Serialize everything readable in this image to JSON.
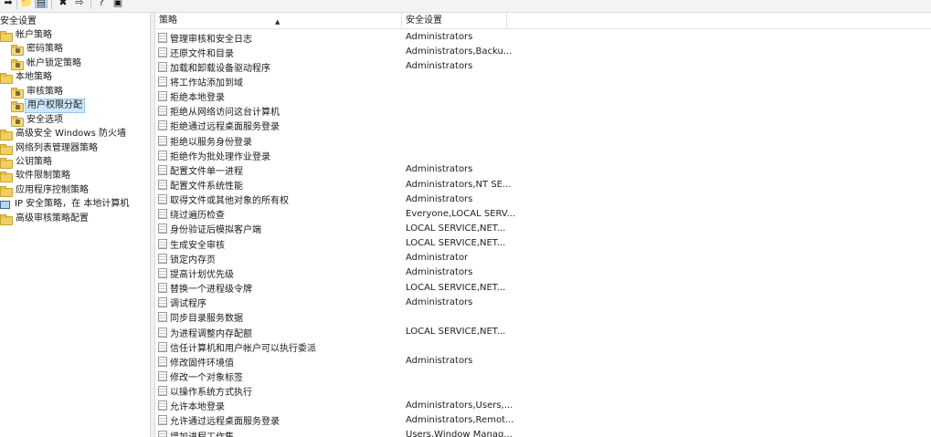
{
  "tree": {
    "items": [
      {
        "label": "安全设置",
        "kind": "root"
      },
      {
        "label": "帐户策略",
        "kind": "folder"
      },
      {
        "label": "密码策略",
        "kind": "locked"
      },
      {
        "label": "帐户锁定策略",
        "kind": "locked"
      },
      {
        "label": "本地策略",
        "kind": "folder"
      },
      {
        "label": "审核策略",
        "kind": "locked"
      },
      {
        "label": "用户权限分配",
        "kind": "locked",
        "selected": true
      },
      {
        "label": "安全选项",
        "kind": "locked"
      },
      {
        "label": "高级安全 Windows 防火墙",
        "kind": "folder"
      },
      {
        "label": "网络列表管理器策略",
        "kind": "folder"
      },
      {
        "label": "公钥策略",
        "kind": "folder"
      },
      {
        "label": "软件限制策略",
        "kind": "folder"
      },
      {
        "label": "应用程序控制策略",
        "kind": "folder"
      },
      {
        "label": "IP 安全策略，在 本地计算机",
        "kind": "pc"
      },
      {
        "label": "高级审核策略配置",
        "kind": "folder"
      }
    ]
  },
  "list": {
    "columns": {
      "policy": "策略",
      "setting": "安全设置"
    },
    "rows": [
      {
        "policy": "管理审核和安全日志",
        "setting": "Administrators"
      },
      {
        "policy": "还原文件和目录",
        "setting": "Administrators,Backu..."
      },
      {
        "policy": "加载和卸载设备驱动程序",
        "setting": "Administrators"
      },
      {
        "policy": "将工作站添加到域",
        "setting": ""
      },
      {
        "policy": "拒绝本地登录",
        "setting": ""
      },
      {
        "policy": "拒绝从网络访问这台计算机",
        "setting": ""
      },
      {
        "policy": "拒绝通过远程桌面服务登录",
        "setting": ""
      },
      {
        "policy": "拒绝以服务身份登录",
        "setting": ""
      },
      {
        "policy": "拒绝作为批处理作业登录",
        "setting": ""
      },
      {
        "policy": "配置文件单一进程",
        "setting": "Administrators"
      },
      {
        "policy": "配置文件系统性能",
        "setting": "Administrators,NT SE..."
      },
      {
        "policy": "取得文件或其他对象的所有权",
        "setting": "Administrators"
      },
      {
        "policy": "绕过遍历检查",
        "setting": "Everyone,LOCAL SERV..."
      },
      {
        "policy": "身份验证后模拟客户端",
        "setting": "LOCAL SERVICE,NET..."
      },
      {
        "policy": "生成安全审核",
        "setting": "LOCAL SERVICE,NET..."
      },
      {
        "policy": "锁定内存页",
        "setting": "Administrator"
      },
      {
        "policy": "提高计划优先级",
        "setting": "Administrators"
      },
      {
        "policy": "替换一个进程级令牌",
        "setting": "LOCAL SERVICE,NET..."
      },
      {
        "policy": "调试程序",
        "setting": "Administrators"
      },
      {
        "policy": "同步目录服务数据",
        "setting": ""
      },
      {
        "policy": "为进程调整内存配额",
        "setting": "LOCAL SERVICE,NET..."
      },
      {
        "policy": "信任计算机和用户帐户可以执行委派",
        "setting": ""
      },
      {
        "policy": "修改固件环境值",
        "setting": "Administrators"
      },
      {
        "policy": "修改一个对象标签",
        "setting": ""
      },
      {
        "policy": "以操作系统方式执行",
        "setting": ""
      },
      {
        "policy": "允许本地登录",
        "setting": "Administrators,Users,..."
      },
      {
        "policy": "允许通过远程桌面服务登录",
        "setting": "Administrators,Remot..."
      },
      {
        "policy": "增加进程工作集",
        "setting": "Users,Window Manag..."
      }
    ]
  }
}
